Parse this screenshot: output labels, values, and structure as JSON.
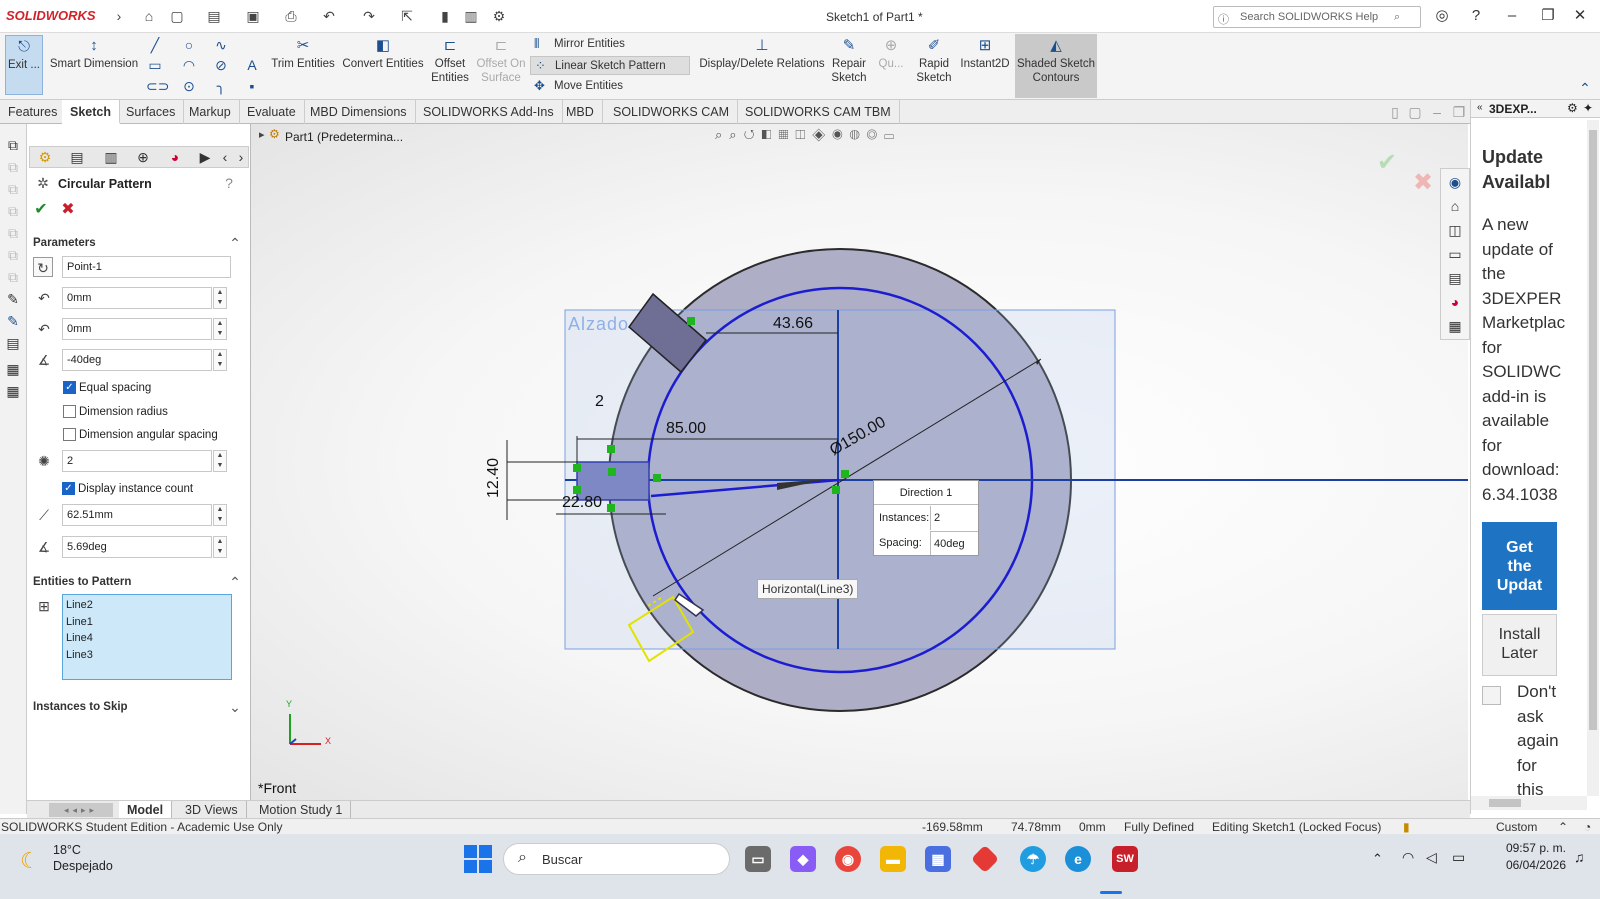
{
  "app": {
    "logo": "SOLIDWORKS",
    "window_title": "Sketch1 of Part1 *",
    "search_placeholder": "Search SOLIDWORKS Help"
  },
  "ribbon": {
    "exit": "Exit ...",
    "smart_dimension": "Smart Dimension",
    "trim": "Trim Entities",
    "convert": "Convert Entities",
    "offset": "Offset Entities",
    "offset_surface": "Offset On Surface",
    "mirror": "Mirror Entities",
    "linear_pattern": "Linear Sketch Pattern",
    "move": "Move Entities",
    "display_relations": "Display/Delete Relations",
    "repair": "Repair Sketch",
    "quick": "Qu...",
    "rapid": "Rapid Sketch",
    "instant2d": "Instant2D",
    "shaded": "Shaded Sketch Contours"
  },
  "tabs": [
    "Features",
    "Sketch",
    "Surfaces",
    "Markup",
    "Evaluate",
    "MBD Dimensions",
    "SOLIDWORKS Add-Ins",
    "MBD",
    "SOLIDWORKS CAM",
    "SOLIDWORKS CAM TBM"
  ],
  "tree": {
    "breadcrumb": "Part1 (Predetermina..."
  },
  "pm": {
    "title": "Circular Pattern",
    "parameters_header": "Parameters",
    "center_point": "Point-1",
    "x_value": "0mm",
    "y_value": "0mm",
    "angle": "-40deg",
    "equal_spacing": "Equal spacing",
    "dimension_radius": "Dimension radius",
    "dimension_angular": "Dimension angular spacing",
    "instances": "2",
    "display_instance_count": "Display instance count",
    "radius": "62.51mm",
    "arc_angle": "5.69deg",
    "entities_header": "Entities to Pattern",
    "entities": [
      "Line2",
      "Line1",
      "Line4",
      "Line3"
    ],
    "skip_header": "Instances to Skip"
  },
  "sketch": {
    "watermark": "Alzado",
    "dim_43": "43.66",
    "dim_2": "2",
    "dim_85": "85.00",
    "dim_150": "Ø150.00",
    "dim_12": "12.40",
    "dim_22": "22.80",
    "dir_title": "Direction 1",
    "dir_instances_label": "Instances:",
    "dir_instances_value": "2",
    "dir_spacing_label": "Spacing:",
    "dir_spacing_value": "40deg",
    "tooltip": "Horizontal(Line3)",
    "view_name": "*Front",
    "axis_y": "Y",
    "axis_x": "X"
  },
  "explorer": {
    "header": "3DEXP...",
    "title_lines": [
      "Update",
      "Availabl"
    ],
    "body_lines": [
      "A new",
      "update of",
      "the",
      "3DEXPER",
      "Marketplac",
      "for",
      "SOLIDWC",
      "add-in is",
      "available",
      "for",
      "download:",
      "6.34.1038"
    ],
    "get_lines": [
      "Get",
      "the",
      "Updat"
    ],
    "install_lines": [
      "Install",
      "Later"
    ],
    "dont_ask_lines": [
      "Don't",
      "ask",
      "again",
      "for",
      "this"
    ]
  },
  "bottom_tabs": [
    "Model",
    "3D Views",
    "Motion Study 1"
  ],
  "status": {
    "edition": "SOLIDWORKS Student Edition - Academic Use Only",
    "x": "-169.58mm",
    "y": "74.78mm",
    "z": "0mm",
    "defined": "Fully Defined",
    "editing": "Editing Sketch1 (Locked Focus)",
    "units": "Custom"
  },
  "taskbar": {
    "temp": "18°C",
    "weather": "Despejado",
    "search": "Buscar",
    "time": "09:57 p. m.",
    "date": "06/04/2026"
  }
}
